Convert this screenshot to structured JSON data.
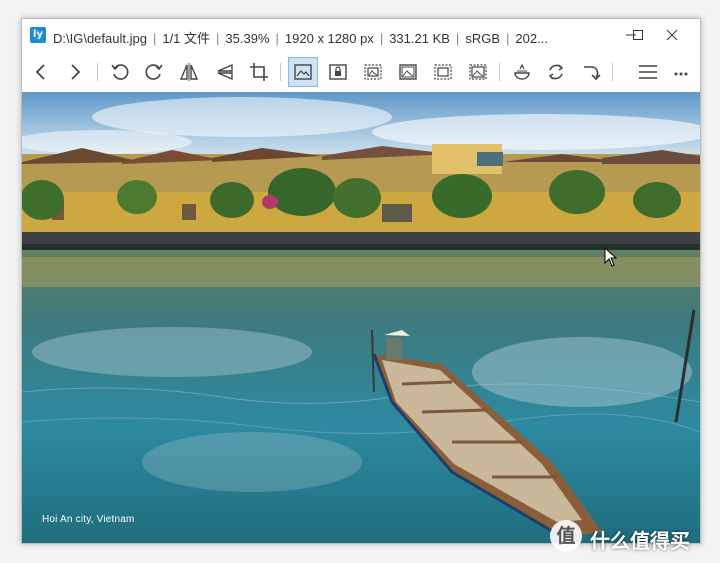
{
  "window": {
    "title_parts": [
      "D:\\IG\\default.jpg",
      "1/1 文件",
      "35.39%",
      "1920 x 1280 px",
      "331.21 KB",
      "sRGB",
      "202..."
    ],
    "app_icon_letter": "ly"
  },
  "toolbar": {
    "icons": [
      "back-icon",
      "forward-icon",
      "rotate-left-icon",
      "rotate-right-icon",
      "flip-horizontal-icon",
      "flip-vertical-icon",
      "crop-icon",
      "fit-window-icon",
      "lock-zoom-icon",
      "zoom-mode-icon",
      "original-size-icon",
      "fit-width-icon",
      "fit-height-icon",
      "slideshow-icon",
      "refresh-icon",
      "redo-icon",
      "menu-icon",
      "more-icon"
    ],
    "active_icon": "fit-window-icon"
  },
  "image": {
    "caption": "Hoi An city, Vietnam"
  },
  "watermark": {
    "logo_char": "值",
    "text": "什么值得买"
  }
}
